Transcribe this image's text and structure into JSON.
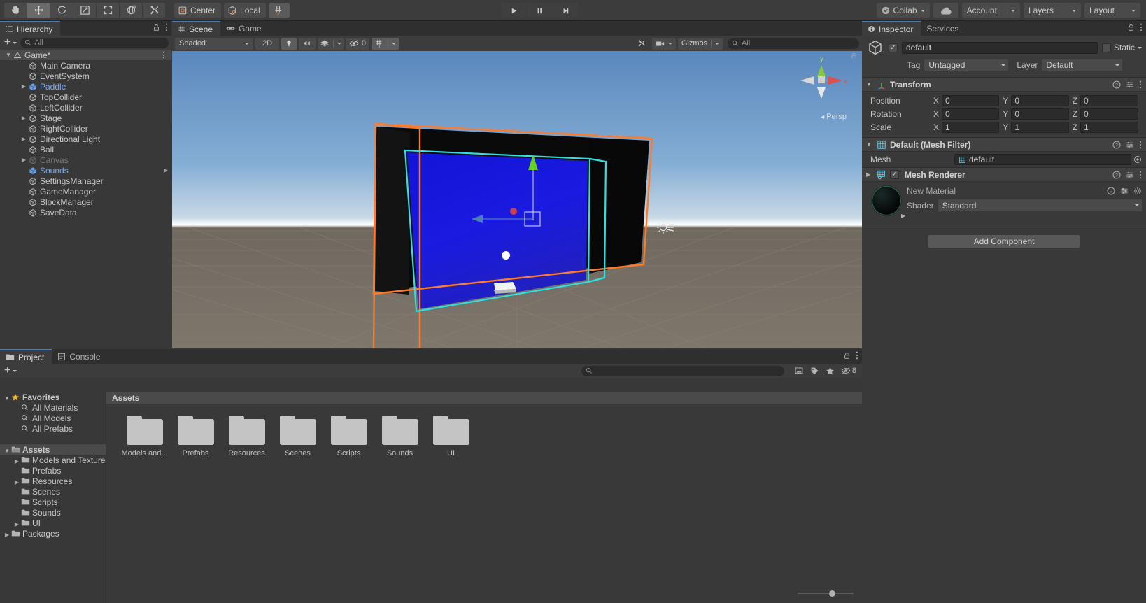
{
  "toolbar": {
    "tools": [
      {
        "name": "hand-tool",
        "icon": "hand",
        "active": false
      },
      {
        "name": "move-tool",
        "icon": "move",
        "active": true
      },
      {
        "name": "rotate-tool",
        "icon": "rotate",
        "active": false
      },
      {
        "name": "scale-tool",
        "icon": "scale",
        "active": false
      },
      {
        "name": "rect-tool",
        "icon": "rect",
        "active": false
      },
      {
        "name": "transform-tool",
        "icon": "transform",
        "active": false
      },
      {
        "name": "custom-tool",
        "icon": "wrench",
        "active": false
      }
    ],
    "pivot_label": "Center",
    "space_label": "Local",
    "grid_label": "",
    "play_label": "▶",
    "pause_label": "‖",
    "step_label": "▶|",
    "collab_label": "Collab",
    "cloud_label": "",
    "account_label": "Account",
    "layers_label": "Layers",
    "layout_label": "Layout"
  },
  "hierarchy": {
    "tab_label": "Hierarchy",
    "search_placeholder": "All",
    "items": [
      {
        "label": "Game*",
        "depth": 0,
        "arrow": "down",
        "icon": "scene",
        "style": "root"
      },
      {
        "label": "Main Camera",
        "depth": 2,
        "arrow": "",
        "icon": "gameobject",
        "style": ""
      },
      {
        "label": "EventSystem",
        "depth": 2,
        "arrow": "",
        "icon": "gameobject",
        "style": ""
      },
      {
        "label": "Paddle",
        "depth": 2,
        "arrow": "right",
        "icon": "prefab",
        "style": "prefab"
      },
      {
        "label": "TopCollider",
        "depth": 2,
        "arrow": "",
        "icon": "gameobject",
        "style": ""
      },
      {
        "label": "LeftCollider",
        "depth": 2,
        "arrow": "",
        "icon": "gameobject",
        "style": ""
      },
      {
        "label": "Stage",
        "depth": 2,
        "arrow": "right",
        "icon": "gameobject",
        "style": ""
      },
      {
        "label": "RightCollider",
        "depth": 2,
        "arrow": "",
        "icon": "gameobject",
        "style": ""
      },
      {
        "label": "Directional Light",
        "depth": 2,
        "arrow": "right",
        "icon": "gameobject",
        "style": ""
      },
      {
        "label": "Ball",
        "depth": 2,
        "arrow": "",
        "icon": "gameobject",
        "style": ""
      },
      {
        "label": "Canvas",
        "depth": 2,
        "arrow": "right",
        "icon": "gameobject",
        "style": "dim"
      },
      {
        "label": "Sounds",
        "depth": 2,
        "arrow": "",
        "icon": "prefab",
        "style": "prefab"
      },
      {
        "label": "SettingsManager",
        "depth": 2,
        "arrow": "",
        "icon": "gameobject",
        "style": ""
      },
      {
        "label": "GameManager",
        "depth": 2,
        "arrow": "",
        "icon": "gameobject",
        "style": ""
      },
      {
        "label": "BlockManager",
        "depth": 2,
        "arrow": "",
        "icon": "gameobject",
        "style": ""
      },
      {
        "label": "SaveData",
        "depth": 2,
        "arrow": "",
        "icon": "gameobject",
        "style": ""
      }
    ]
  },
  "scene": {
    "tabs": [
      {
        "label": "Scene",
        "icon": "scene-icon",
        "selected": true
      },
      {
        "label": "Game",
        "icon": "game-icon",
        "selected": false
      }
    ],
    "draw_mode": "Shaded",
    "mode_2d": "2D",
    "audio_count": "0",
    "gizmos_label": "Gizmos",
    "search_placeholder": "All",
    "persp_label": "Persp",
    "axis_labels": {
      "y": "y",
      "x": "x"
    }
  },
  "inspector": {
    "tabs": [
      {
        "label": "Inspector",
        "selected": true
      },
      {
        "label": "Services",
        "selected": false
      }
    ],
    "object_name": "default",
    "object_enabled": true,
    "static_label": "Static",
    "tag_label": "Tag",
    "tag_value": "Untagged",
    "layer_label": "Layer",
    "layer_value": "Default",
    "components": [
      {
        "title": "Transform",
        "icon": "transform-icon",
        "expanded": true,
        "rows": [
          {
            "name": "Position",
            "x": "0",
            "y": "0",
            "z": "0"
          },
          {
            "name": "Rotation",
            "x": "0",
            "y": "0",
            "z": "0"
          },
          {
            "name": "Scale",
            "x": "1",
            "y": "1",
            "z": "1"
          }
        ]
      },
      {
        "title": "Default (Mesh Filter)",
        "icon": "mesh-filter-icon",
        "expanded": true,
        "mesh_label": "Mesh",
        "mesh_value": "default"
      },
      {
        "title": "Mesh Renderer",
        "icon": "mesh-renderer-icon",
        "expanded": false,
        "enabled": true
      }
    ],
    "material": {
      "name": "New Material",
      "shader_label": "Shader",
      "shader_value": "Standard"
    },
    "add_component_label": "Add Component"
  },
  "project": {
    "tabs": [
      {
        "label": "Project",
        "icon": "folder-icon",
        "selected": true
      },
      {
        "label": "Console",
        "icon": "console-icon",
        "selected": false
      }
    ],
    "search_placeholder": "",
    "badge_count": "8",
    "tree": [
      {
        "label": "Favorites",
        "depth": 0,
        "arrow": "down",
        "icon": "star",
        "sel": false
      },
      {
        "label": "All Materials",
        "depth": 1,
        "arrow": "",
        "icon": "search",
        "sel": false
      },
      {
        "label": "All Models",
        "depth": 1,
        "arrow": "",
        "icon": "search",
        "sel": false
      },
      {
        "label": "All Prefabs",
        "depth": 1,
        "arrow": "",
        "icon": "search",
        "sel": false
      },
      {
        "label": "",
        "depth": 0,
        "arrow": "",
        "icon": "spacer",
        "sel": false
      },
      {
        "label": "Assets",
        "depth": 0,
        "arrow": "down",
        "icon": "folder-open",
        "sel": true
      },
      {
        "label": "Models and Texture",
        "depth": 1,
        "arrow": "right",
        "icon": "folder",
        "sel": false
      },
      {
        "label": "Prefabs",
        "depth": 1,
        "arrow": "",
        "icon": "folder",
        "sel": false
      },
      {
        "label": "Resources",
        "depth": 1,
        "arrow": "right",
        "icon": "folder",
        "sel": false
      },
      {
        "label": "Scenes",
        "depth": 1,
        "arrow": "",
        "icon": "folder",
        "sel": false
      },
      {
        "label": "Scripts",
        "depth": 1,
        "arrow": "",
        "icon": "folder",
        "sel": false
      },
      {
        "label": "Sounds",
        "depth": 1,
        "arrow": "",
        "icon": "folder",
        "sel": false
      },
      {
        "label": "UI",
        "depth": 1,
        "arrow": "right",
        "icon": "folder",
        "sel": false
      },
      {
        "label": "Packages",
        "depth": 0,
        "arrow": "right",
        "icon": "folder",
        "sel": false
      }
    ],
    "breadcrumb": "Assets",
    "assets": [
      {
        "label": "Models and...",
        "type": "folder"
      },
      {
        "label": "Prefabs",
        "type": "folder"
      },
      {
        "label": "Resources",
        "type": "folder"
      },
      {
        "label": "Scenes",
        "type": "folder"
      },
      {
        "label": "Scripts",
        "type": "folder"
      },
      {
        "label": "Sounds",
        "type": "folder"
      },
      {
        "label": "UI",
        "type": "folder"
      }
    ]
  },
  "colors": {
    "accent_blue": "#4a7ebb",
    "prefab_blue": "#7ba9e8",
    "selection_orange": "#ff7b29",
    "selection_cyan": "#2fe0e0",
    "panel_bg": "#383838",
    "toolbar_bg": "#3c3c3c"
  }
}
